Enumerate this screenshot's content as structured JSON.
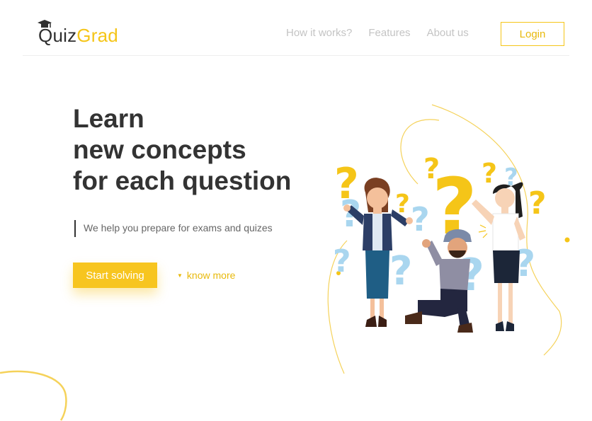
{
  "brand": {
    "q": "Q",
    "quiz": "uiz",
    "grad": "Grad"
  },
  "nav": {
    "items": [
      "How it works?",
      "Features",
      "About us"
    ],
    "login_label": "Login"
  },
  "hero": {
    "title_lines": [
      "Learn",
      "new concepts",
      "for each question"
    ],
    "subtitle": "We help you prepare for exams and quizes",
    "cta_label": "Start solving",
    "secondary_label": "know more"
  },
  "colors": {
    "accent": "#f5c518",
    "heading": "#333333",
    "muted_nav": "#c4c4c4",
    "question_blue": "#a9d6ef"
  },
  "icons": {
    "logo_cap": "graduation-cap-icon",
    "know_more": "triangle-down-icon"
  }
}
